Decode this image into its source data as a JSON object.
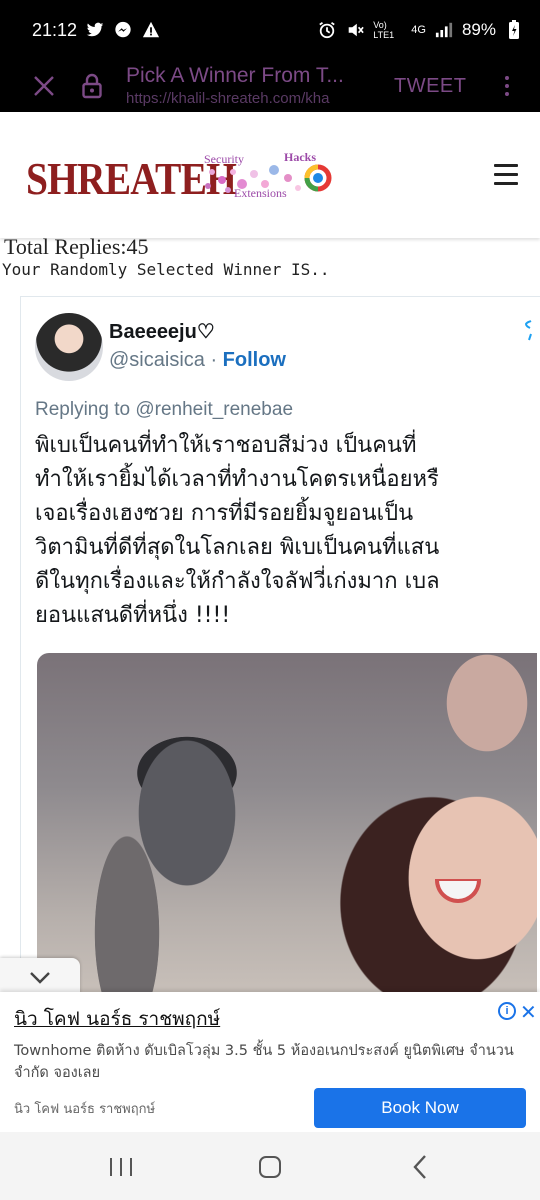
{
  "status_bar": {
    "time": "21:12",
    "battery": "89%",
    "network": "4G",
    "volte": "Vo) LTE1"
  },
  "browser": {
    "page_title": "Pick A Winner From T...",
    "url": "https://khalil-shreateh.com/kha",
    "tweet_button": "TWEET"
  },
  "site": {
    "logo_main": "SHREATEH",
    "logo_security": "Security",
    "logo_hacks": "Hacks",
    "logo_extensions": "Extensions"
  },
  "results": {
    "total_replies": "Total Replies:45",
    "winner_label": "Your Randomly Selected Winner IS.."
  },
  "tweet": {
    "display_name": "Baeeeeju♡",
    "handle": "@sicaisica",
    "separator": " · ",
    "follow_label": "Follow",
    "replying_to": "Replying to @renheit_renebae",
    "text_lines": [
      "พิเบเป็นคนที่ทำให้เราชอบสีม่วง เป็นคนที่",
      "ทำให้เรายิ้มได้เวลาที่ทำงานโคตรเหนื่อยหรื",
      "เจอเรื่องเฮงซวย การที่มีรอยยิ้มจูยอนเป็น",
      "วิตามินที่ดีที่สุดในโลกเลย พิเบเป็นคนที่แสน",
      "ดีในทุกเรื่องและให้กำลังใจลัฟวี่เก่งมาก เบล",
      "ยอนแสนดีที่หนึ่ง !!!!"
    ]
  },
  "ad": {
    "title": "นิว โคฟ นอร์ธ ราชพฤกษ์",
    "body": "Townhome ติดห้าง ดับเบิลโวลุ่ม 3.5 ชั้น 5 ห้องอเนกประสงค์ ยูนิตพิเศษ จำนวนจำกัด จองเลย",
    "advertiser": "นิว โคฟ นอร์ธ ราชพฤกษ์",
    "cta": "Book Now"
  },
  "colors": {
    "browser_accent": "#7c4a86",
    "follow_blue": "#1b6fbf",
    "ad_button": "#1a73e8",
    "logo_red": "#8e1f1f"
  }
}
